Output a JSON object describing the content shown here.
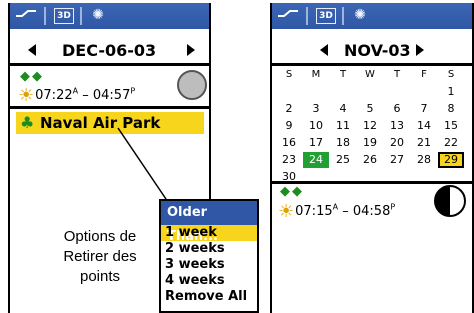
{
  "left_screen": {
    "topbar_icons": [
      "map-pin-icon",
      "3d-icon",
      "bulb-icon"
    ],
    "threeD_label": "3D",
    "date": "DEC-06-03",
    "fish_icons": "fish-icon",
    "sunrise": "07:22",
    "sunrise_ampm": "A",
    "sun_dash": "–",
    "sunset": "04:57",
    "sunset_ampm": "P",
    "waypoint": "Naval Air Park"
  },
  "caption": {
    "line1": "Options de",
    "line2": "Retirer des",
    "line3": "points"
  },
  "menu": {
    "title": "Older Than...",
    "items": [
      {
        "label": "1 week",
        "selected": true
      },
      {
        "label": "2 weeks",
        "selected": false
      },
      {
        "label": "3 weeks",
        "selected": false
      },
      {
        "label": "4 weeks",
        "selected": false
      },
      {
        "label": "Remove All",
        "selected": false
      }
    ]
  },
  "right_screen": {
    "threeD_label": "3D",
    "month": "NOV-03",
    "weekday_headers": [
      "S",
      "M",
      "T",
      "W",
      "T",
      "F",
      "S"
    ],
    "weeks": [
      [
        "",
        "",
        "",
        "",
        "",
        "",
        "1"
      ],
      [
        "2",
        "3",
        "4",
        "5",
        "6",
        "7",
        "8"
      ],
      [
        "9",
        "10",
        "11",
        "12",
        "13",
        "14",
        "15"
      ],
      [
        "16",
        "17",
        "18",
        "19",
        "20",
        "21",
        "22"
      ],
      [
        "23",
        "24",
        "25",
        "26",
        "27",
        "28",
        "29"
      ],
      [
        "30",
        "",
        "",
        "",
        "",
        "",
        ""
      ]
    ],
    "today": "24",
    "selected": "29",
    "sunrise": "07:15",
    "sunrise_ampm": "A",
    "sun_dash": "–",
    "sunset": "04:58",
    "sunset_ampm": "P"
  },
  "colors": {
    "title_bar": "#2f57a6",
    "highlight": "#f7d51d",
    "today_green": "#22a033",
    "icon_green": "#1f8c1f",
    "sun": "#e0a000"
  }
}
